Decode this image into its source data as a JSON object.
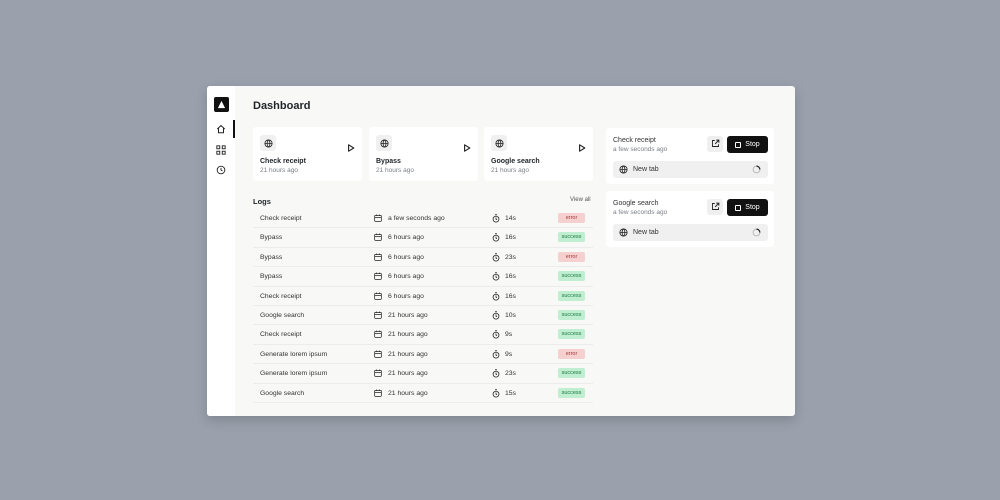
{
  "page": {
    "title": "Dashboard"
  },
  "sidebar": {
    "items": [
      {
        "icon": "home-icon",
        "active": true
      },
      {
        "icon": "workflow-icon",
        "active": false
      },
      {
        "icon": "history-icon",
        "active": false
      }
    ]
  },
  "tasks": [
    {
      "name": "Check receipt",
      "time": "21 hours ago"
    },
    {
      "name": "Bypass",
      "time": "21 hours ago"
    },
    {
      "name": "Google search",
      "time": "21 hours ago"
    }
  ],
  "logs": {
    "title": "Logs",
    "view_all_label": "View all",
    "rows": [
      {
        "name": "Check receipt",
        "when": "a few seconds ago",
        "duration": "14s",
        "status": "error"
      },
      {
        "name": "Bypass",
        "when": "6 hours ago",
        "duration": "16s",
        "status": "success"
      },
      {
        "name": "Bypass",
        "when": "6 hours ago",
        "duration": "23s",
        "status": "error"
      },
      {
        "name": "Bypass",
        "when": "6 hours ago",
        "duration": "16s",
        "status": "success"
      },
      {
        "name": "Check receipt",
        "when": "6 hours ago",
        "duration": "16s",
        "status": "success"
      },
      {
        "name": "Google search",
        "when": "21 hours ago",
        "duration": "10s",
        "status": "success"
      },
      {
        "name": "Check receipt",
        "when": "21 hours ago",
        "duration": "9s",
        "status": "success"
      },
      {
        "name": "Generate lorem ipsum",
        "when": "21 hours ago",
        "duration": "9s",
        "status": "error"
      },
      {
        "name": "Generate lorem ipsum",
        "when": "21 hours ago",
        "duration": "23s",
        "status": "success"
      },
      {
        "name": "Google search",
        "when": "21 hours ago",
        "duration": "15s",
        "status": "success"
      }
    ]
  },
  "running": [
    {
      "name": "Check receipt",
      "time": "a few seconds ago",
      "stop_label": "Stop",
      "tab_label": "New tab"
    },
    {
      "name": "Google search",
      "time": "a few seconds ago",
      "stop_label": "Stop",
      "tab_label": "New tab"
    }
  ],
  "colors": {
    "background": "#9aa1ad",
    "error_bg": "#f6cfcf",
    "success_bg": "#bfeed0",
    "primary": "#111111"
  }
}
